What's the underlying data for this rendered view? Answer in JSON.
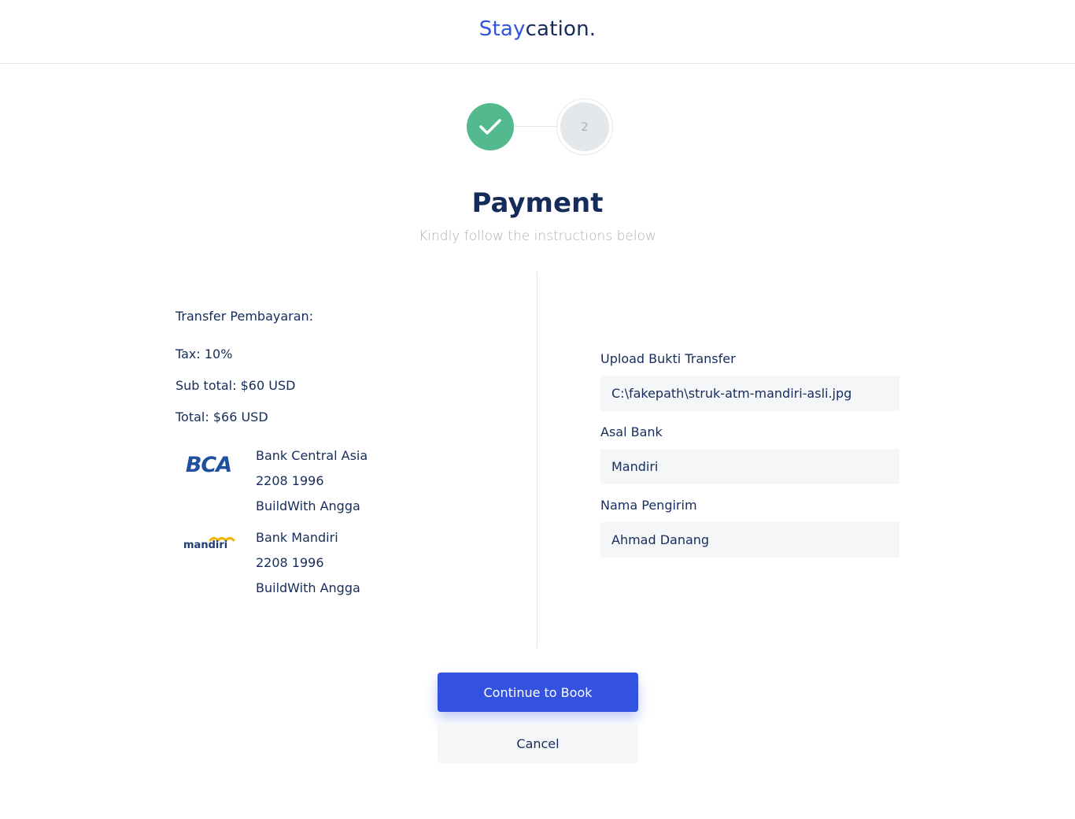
{
  "header": {
    "brand_accent": "Stay",
    "brand_rest": "cation."
  },
  "stepper": {
    "step1_state": "completed",
    "step2_label": "2"
  },
  "page": {
    "title": "Payment",
    "subtitle": "Kindly follow the instructions below"
  },
  "summary": {
    "heading": "Transfer Pembayaran:",
    "tax": "Tax: 10%",
    "subtotal": "Sub total: $60 USD",
    "total": "Total: $66 USD"
  },
  "banks": [
    {
      "logo": "BCA",
      "name": "Bank Central Asia",
      "account": "2208 1996",
      "holder": "BuildWith Angga"
    },
    {
      "logo": "mandiri",
      "name": "Bank Mandiri",
      "account": "2208 1996",
      "holder": "BuildWith Angga"
    }
  ],
  "form": {
    "upload_label": "Upload Bukti Transfer",
    "upload_value": "C:\\fakepath\\struk-atm-mandiri-asli.jpg",
    "bank_label": "Asal Bank",
    "bank_value": "Mandiri",
    "sender_label": "Nama Pengirim",
    "sender_value": "Ahmad Danang"
  },
  "actions": {
    "continue_label": "Continue to Book",
    "cancel_label": "Cancel"
  },
  "colors": {
    "primary": "#3252df",
    "navy": "#152c5b",
    "success": "#53b98e",
    "muted": "#b0b0b0",
    "input_bg": "#f5f6f8"
  }
}
